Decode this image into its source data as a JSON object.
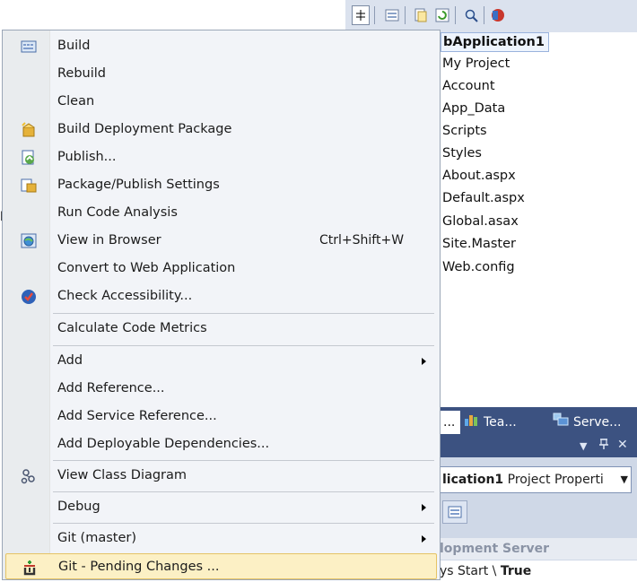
{
  "solution_explorer": {
    "root": "bApplication1",
    "items": [
      "My Project",
      "Account",
      "App_Data",
      "Scripts",
      "Styles",
      "About.aspx",
      "Default.aspx",
      "Global.asax",
      "Site.Master",
      "Web.config"
    ],
    "side_fragment": "p"
  },
  "tabs": {
    "first_fragment": "...",
    "team": "Tea...",
    "server": "Serve..."
  },
  "properties": {
    "pin": "ᵖ",
    "close": "✕",
    "combo_bold": "lication1",
    "combo_rest": " Project Properti",
    "category": "lopment Server",
    "row_name": "ys Start \\ ",
    "row_value": "True"
  },
  "menu": {
    "items": [
      {
        "label": "Build",
        "icon": "build-icon"
      },
      {
        "label": "Rebuild"
      },
      {
        "label": "Clean"
      },
      {
        "label": "Build Deployment Package",
        "icon": "package-icon"
      },
      {
        "label": "Publish...",
        "icon": "publish-icon"
      },
      {
        "label": "Package/Publish Settings",
        "icon": "settings-icon"
      },
      {
        "label": "Run Code Analysis"
      },
      {
        "label": "View in Browser",
        "icon": "browser-icon",
        "shortcut": "Ctrl+Shift+W"
      },
      {
        "label": "Convert to Web Application"
      },
      {
        "label": "Check Accessibility...",
        "icon": "accessibility-icon"
      },
      {
        "label": "Calculate Code Metrics"
      },
      {
        "label": "Add",
        "submenu": true
      },
      {
        "label": "Add Reference..."
      },
      {
        "label": "Add Service Reference..."
      },
      {
        "label": "Add Deployable Dependencies..."
      },
      {
        "label": "View Class Diagram",
        "icon": "class-diagram-icon"
      },
      {
        "label": "Debug",
        "submenu": true
      },
      {
        "label": "Git (master)",
        "submenu": true
      },
      {
        "label": "Git - Pending Changes ...",
        "icon": "git-icon",
        "highlighted": true
      }
    ]
  }
}
